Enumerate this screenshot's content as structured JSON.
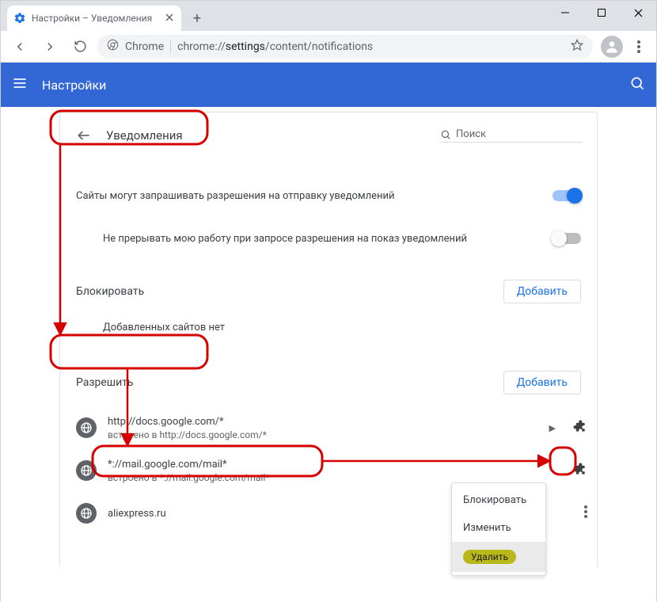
{
  "window": {
    "tab_title": "Настройки – Уведомления"
  },
  "omnibox": {
    "system_label": "Chrome",
    "url_scheme": "chrome://",
    "url_host": "settings",
    "url_path": "/content/notifications"
  },
  "appbar": {
    "title": "Настройки"
  },
  "panel": {
    "back_label": "Уведомления",
    "search_placeholder": "Поиск",
    "ask_row": "Сайты могут запрашивать разрешения на отправку уведомлений",
    "quiet_row": "Не прерывать мою работу при запросе разрешения на показ уведомлений",
    "block_section": "Блокировать",
    "block_empty": "Добавленных сайтов нет",
    "allow_section": "Разрешить",
    "add_btn": "Добавить"
  },
  "allow": [
    {
      "site": "http://docs.google.com/*",
      "sub": "встроено в http://docs.google.com/*"
    },
    {
      "site": "*://mail.google.com/mail*",
      "sub": "встроено в *://mail.google.com/mail*"
    },
    {
      "site": "aliexpress.ru",
      "sub": ""
    }
  ],
  "menu": {
    "block": "Блокировать",
    "edit": "Изменить",
    "remove": "Удалить"
  }
}
